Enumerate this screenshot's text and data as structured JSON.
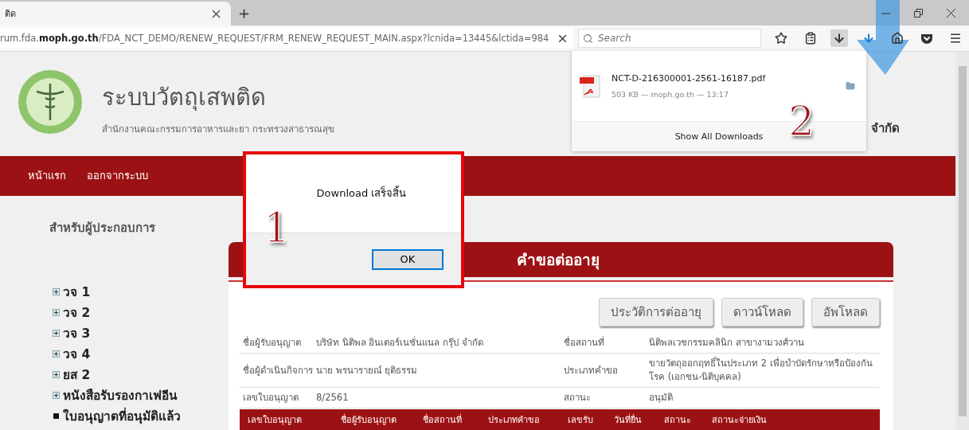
{
  "browser": {
    "tab": {
      "title": "ติด"
    },
    "new_tab": "+",
    "address": "rum.fda.**moph.go.th**/FDA_NCT_DEMO/RENEW_REQUEST/FRM_RENEW_REQUEST_MAIN.aspx?lcnida=13445&lctida=984",
    "search": {
      "placeholder": "Search"
    },
    "toolbar": [
      {
        "kind": "bookmark",
        "pressed": false
      },
      {
        "kind": "reading",
        "pressed": false
      },
      {
        "kind": "downloads",
        "pressed": true
      },
      {
        "kind": "progress",
        "pressed": false
      },
      {
        "kind": "home",
        "pressed": false
      },
      {
        "kind": "pocket",
        "pressed": false
      },
      {
        "kind": "menu",
        "pressed": false
      }
    ]
  },
  "header": {
    "title": "ระบบวัตถุเสพติด",
    "subtitle": "สำนักงานคณะกรรมการอาหารและยา กระทรวงสาธารณสุข",
    "company_tail": "จำกัด"
  },
  "nav": [
    "หน้าแรก",
    "ออกจากระบบ"
  ],
  "sidebar": {
    "heading": "สำหรับผู้ประกอบการ",
    "items": [
      {
        "label": "วจ 1",
        "kind": "expandable"
      },
      {
        "label": "วจ 2",
        "kind": "expandable"
      },
      {
        "label": "วจ 3",
        "kind": "expandable"
      },
      {
        "label": "วจ 4",
        "kind": "expandable"
      },
      {
        "label": "ยส 2",
        "kind": "expandable"
      },
      {
        "label": "หนังสือรับรองกาเฟอีน",
        "kind": "expandable"
      },
      {
        "label": "ใบอนุญาตที่อนุมัติแล้ว",
        "kind": "leaf"
      }
    ]
  },
  "panel": {
    "title": "คำขอต่ออายุ",
    "buttons": [
      "ประวัติการต่ออายุ",
      "ดาวน์โหลด",
      "อัพโหลด"
    ],
    "info": [
      {
        "label_1": "ชื่อผู้รับอนุญาต",
        "value_1": "บริษัท นิติพล อินเตอร์เนชั่นแนล กรุ๊ป จำกัด",
        "label_2": "ชื่อสถานที่",
        "value_2": "นิติพลเวชกรรมคลินิก สาขางามวงศ์วาน"
      },
      {
        "label_1": "ชื่อผู้ดำเนินกิจการ",
        "value_1": "นาย พรนารายณ์ ยุติธรรม",
        "label_2": "ประเภทคำขอ",
        "value_2": "ขายวัตถุออกฤทธิ์ในประเภท 2 เพื่อบำบัดรักษาหรือป้องกันโรค (เอกชน-นิติบุคคล)"
      },
      {
        "label_1": "เลขใบอนุญาต",
        "value_1": "8/2561",
        "label_2": "สถานะ",
        "value_2": "อนุมัติ"
      }
    ],
    "columns": [
      "เลขใบอนุญาต",
      "ชื่อผู้รับอนุญาต",
      "ชื่อสถานที่",
      "ประเภทคำขอ",
      "เลขรับ",
      "วันที่ยื่น",
      "สถานะ",
      "สถานะจ่ายเงิน"
    ]
  },
  "downloads": {
    "file": "NCT-D-216300001-2561-16187.pdf",
    "meta": "503 KB — moph.go.th — 13:17",
    "show_all": "Show All Downloads",
    "annotation": "2"
  },
  "dialog": {
    "message": "Download เสร็จสิ้น",
    "button": "OK",
    "annotation": "1"
  }
}
